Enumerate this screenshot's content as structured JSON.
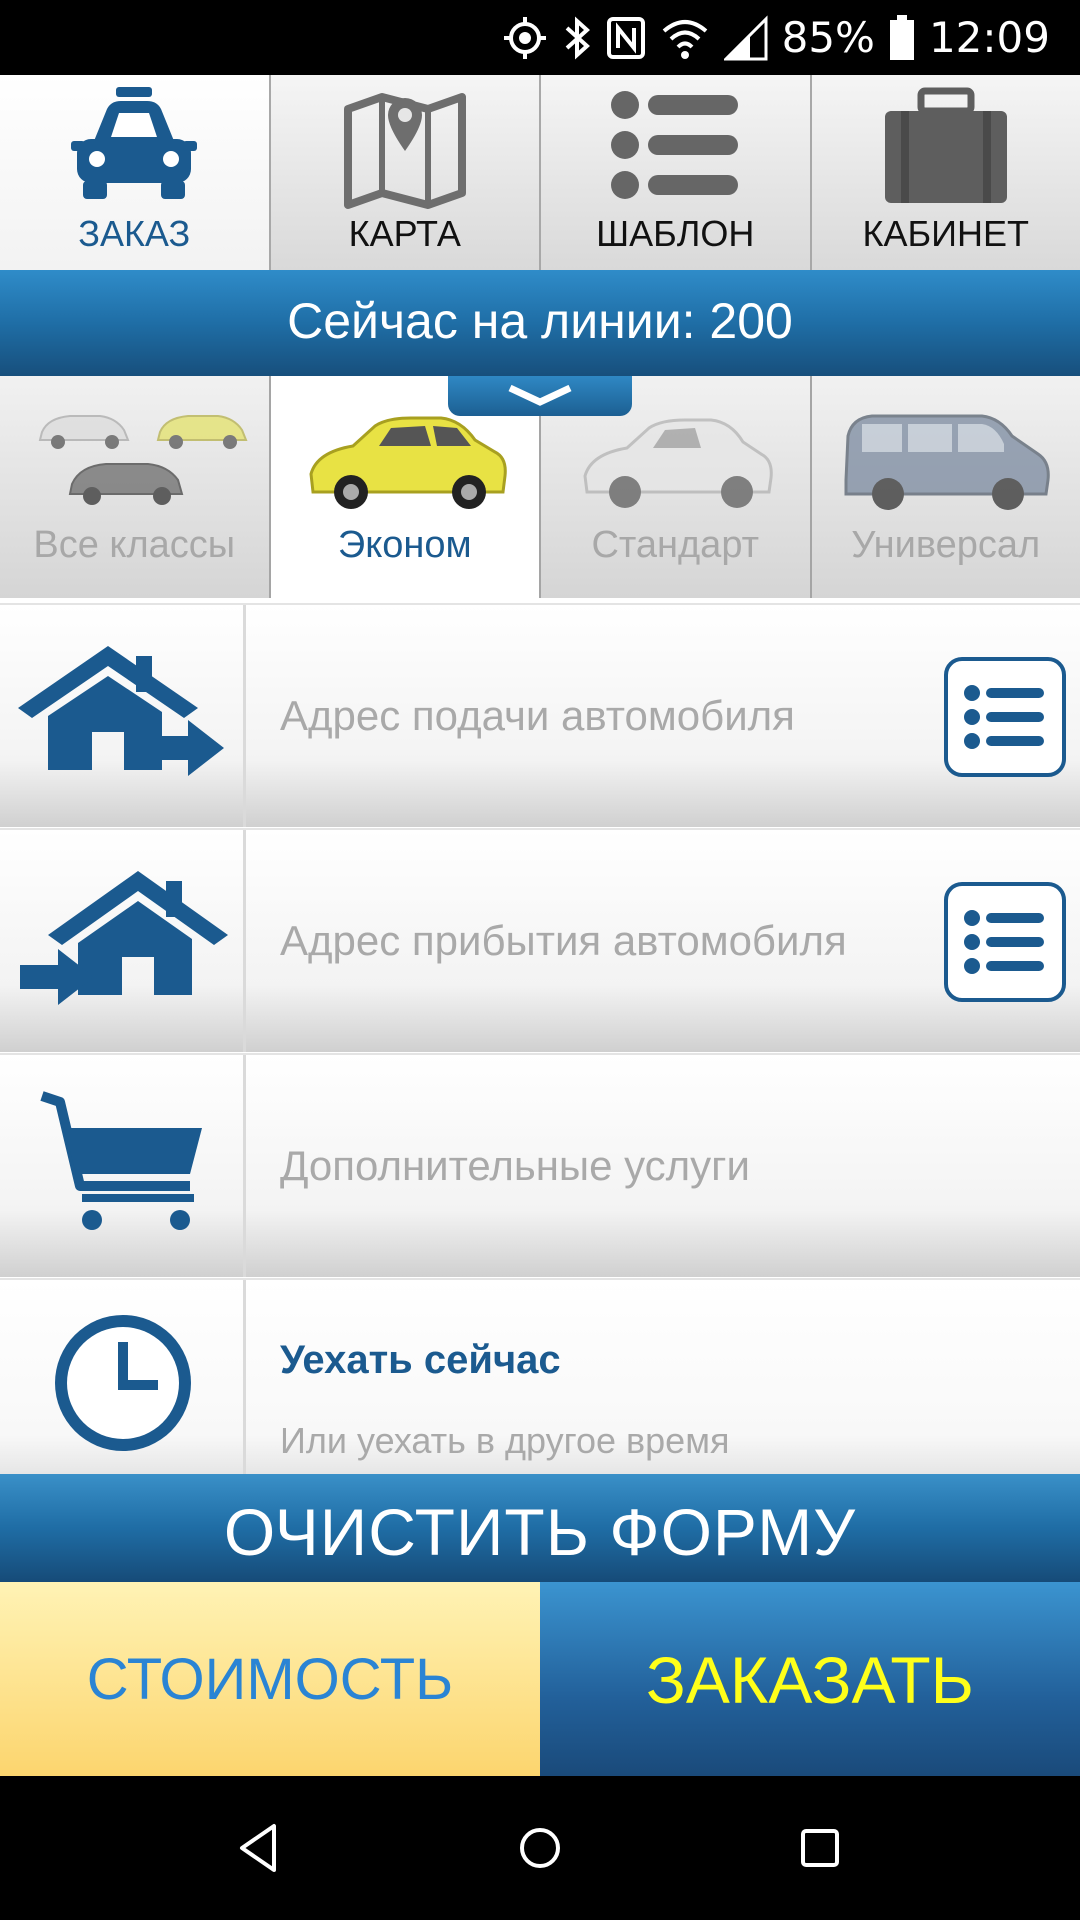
{
  "status_bar": {
    "battery": "85%",
    "time": "12:09"
  },
  "top_tabs": [
    {
      "label": "ЗАКАЗ",
      "icon": "taxi-car-icon",
      "active": true
    },
    {
      "label": "КАРТА",
      "icon": "map-pin-icon",
      "active": false
    },
    {
      "label": "ШАБЛОН",
      "icon": "list-icon",
      "active": false
    },
    {
      "label": "КАБИНЕТ",
      "icon": "briefcase-icon",
      "active": false
    }
  ],
  "online": {
    "text": "Сейчас на линии: 200"
  },
  "car_classes": [
    {
      "label": "Все классы",
      "active": false
    },
    {
      "label": "Эконом",
      "active": true
    },
    {
      "label": "Стандарт",
      "active": false
    },
    {
      "label": "Универсал",
      "active": false
    }
  ],
  "rows": {
    "pickup": {
      "placeholder": "Адрес подачи автомобиля",
      "icon": "house-arrow-out-icon"
    },
    "destination": {
      "placeholder": "Адрес прибытия автомобиля",
      "icon": "house-arrow-in-icon"
    },
    "services": {
      "placeholder": "Дополнительные услуги",
      "icon": "cart-icon"
    },
    "time": {
      "main": "Уехать сейчас",
      "sub": "Или уехать в другое время",
      "icon": "clock-icon"
    }
  },
  "buttons": {
    "clear": "ОЧИСТИТЬ ФОРМУ",
    "cost": "СТОИМОСТЬ",
    "order": "ЗАКАЗАТЬ"
  },
  "colors": {
    "accent_blue": "#1b5a8f",
    "order_text": "#ffff1a",
    "cost_text": "#2a84d4"
  }
}
